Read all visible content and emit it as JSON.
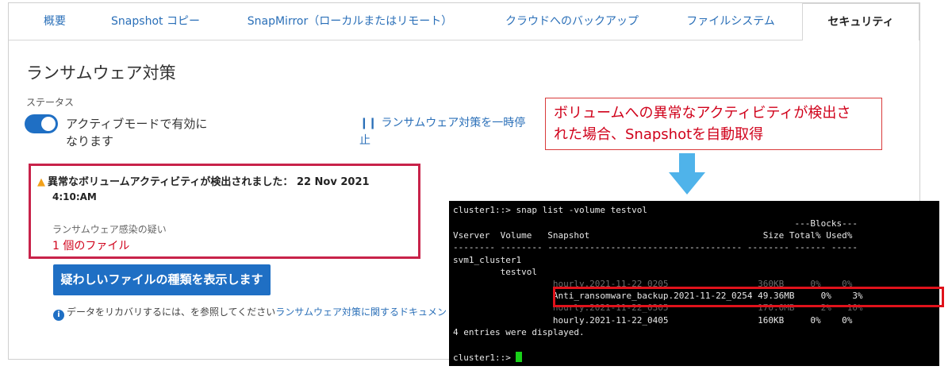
{
  "tabs": [
    "概要",
    "Snapshot コピー",
    "SnapMirror（ローカルまたはリモート）",
    "クラウドへのバックアップ",
    "ファイルシステム",
    "セキュリティ"
  ],
  "active_tab": "セキュリティ",
  "page_title": "ランサムウェア対策",
  "status": {
    "label": "ステータス",
    "toggle_text": "アクティブモードで有効になります",
    "pause_link": "ランサムウェア対策を一時停止"
  },
  "alert": {
    "heading": "異常なボリュームアクティビティが検出されました：",
    "date": "22 Nov 2021",
    "time": "4:10:AM",
    "suspicion_label": "ランサムウェア感染の疑い",
    "files": "1 個のファイル"
  },
  "show_button": "疑わしいファイルの種類を表示します",
  "recover": {
    "text": "データをリカバリするには、を参照してください",
    "link": "ランサムウェア対策に関するドキュメン"
  },
  "callout": {
    "line1": "ボリュームへの異常なアクティビティが検出さ",
    "line2": "れた場合、Snapshotを自動取得"
  },
  "terminal": {
    "lines": [
      "cluster1::> snap list -volume testvol",
      "                                                                 ---Blocks---",
      "Vserver  Volume   Snapshot                                 Size Total% Used%",
      "-------- -------- ------------------------------------- -------- ------ -----",
      "svm1_cluster1",
      "         testvol",
      "                   hourly.2021-11-22_0205                 360KB     0%    0%",
      "                   Anti_ransomware_backup.2021-11-22_0254 49.36MB     0%    3%",
      "                   hourly.2021-11-22_0305                 170.0MB     2%   10%",
      "                   hourly.2021-11-22_0405                 160KB     0%    0%",
      "4 entries were displayed.",
      "",
      "cluster1::> "
    ]
  },
  "colors": {
    "accent": "#1f6fc4",
    "link": "#2a6fb8",
    "alert_border": "#c8234a",
    "error_text": "#d0021b",
    "terminal_bg": "#000000",
    "cursor": "#19d119"
  },
  "icons": {
    "warning": "warning-triangle-icon",
    "info": "info-circle-icon",
    "pause": "pause-icon",
    "arrow": "down-arrow-icon"
  }
}
